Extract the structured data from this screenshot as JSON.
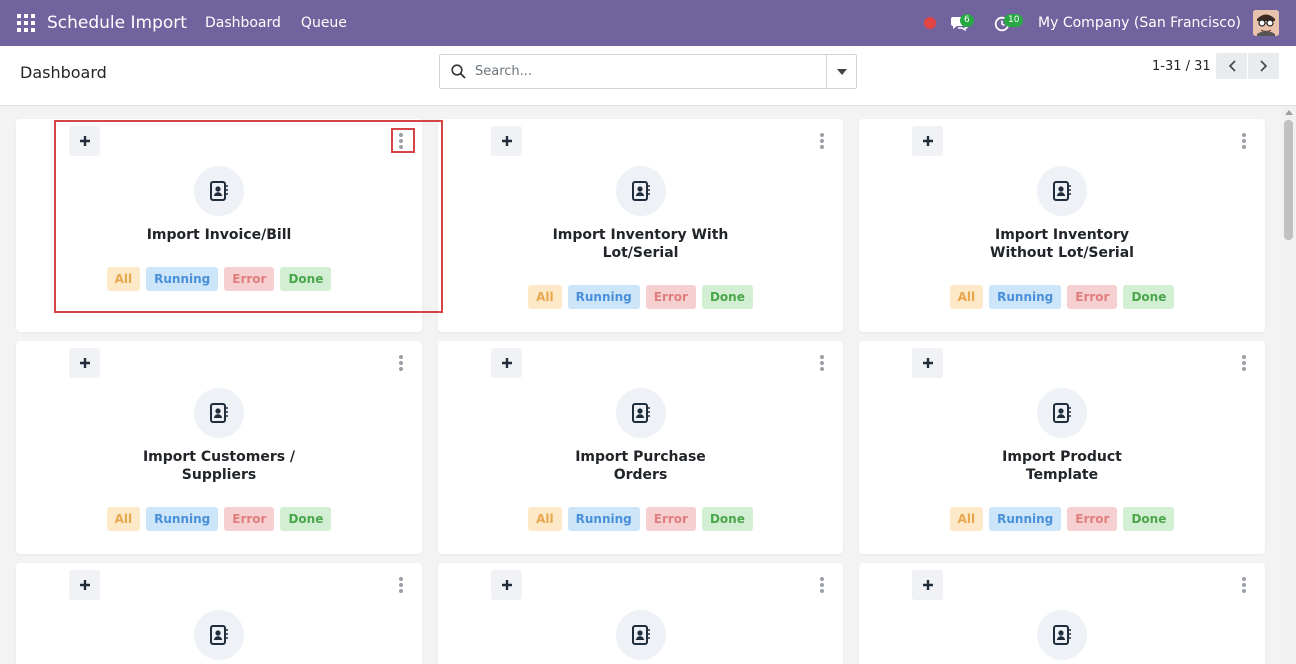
{
  "navbar": {
    "brand": "Schedule Import",
    "links": [
      "Dashboard",
      "Queue"
    ],
    "messages_count": "6",
    "activities_count": "10",
    "company": "My Company (San Francisco)"
  },
  "control_panel": {
    "breadcrumb": "Dashboard",
    "search_placeholder": "Search...",
    "pager": "1-31 / 31"
  },
  "tags": {
    "all": "All",
    "running": "Running",
    "error": "Error",
    "done": "Done"
  },
  "cards": [
    {
      "title_lines": [
        "Import Invoice/Bill"
      ]
    },
    {
      "title_lines": [
        "Import Inventory With",
        "Lot/Serial"
      ]
    },
    {
      "title_lines": [
        "Import Inventory",
        "Without Lot/Serial"
      ]
    },
    {
      "title_lines": [
        "Import Customers /",
        "Suppliers"
      ]
    },
    {
      "title_lines": [
        "Import Purchase",
        "Orders"
      ]
    },
    {
      "title_lines": [
        "Import Product",
        "Template"
      ]
    }
  ],
  "colors": {
    "navbar": "#71639e",
    "tag_all": "#e8a74c",
    "tag_running": "#4a90d9",
    "tag_error": "#e07e7e",
    "tag_done": "#4aa64a",
    "highlight": "#d64545"
  },
  "icons": {
    "apps": "apps-grid-icon",
    "record": "record-dot-icon",
    "messages": "chat-icon",
    "activities": "clock-icon",
    "search": "search-icon",
    "dropdown": "caret-down-icon",
    "prev": "chevron-left-icon",
    "next": "chevron-right-icon",
    "add": "plus-icon",
    "menu": "kebab-menu-icon",
    "card_main": "address-book-icon"
  }
}
